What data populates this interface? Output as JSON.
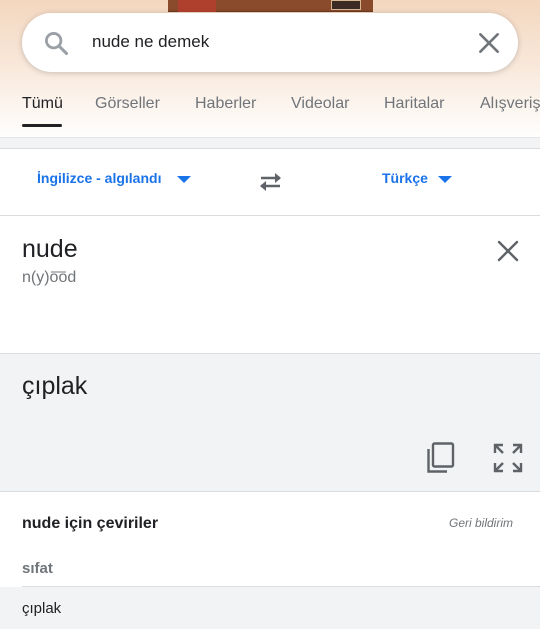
{
  "search": {
    "query": "nude ne demek",
    "icon": "search-icon",
    "clear_icon": "close-icon"
  },
  "tabs": [
    {
      "label": "Tümü",
      "active": true
    },
    {
      "label": "Görseller",
      "active": false
    },
    {
      "label": "Haberler",
      "active": false
    },
    {
      "label": "Videolar",
      "active": false
    },
    {
      "label": "Haritalar",
      "active": false
    },
    {
      "label": "Alışveriş",
      "active": false
    }
  ],
  "translator": {
    "source_lang": "İngilizce - algılandı",
    "target_lang": "Türkçe",
    "source_text": "nude",
    "phonetic": "n(y)o͞od",
    "target_text": "çıplak"
  },
  "translations": {
    "heading": "nude için çeviriler",
    "feedback": "Geri bildirim",
    "part_of_speech": "sıfat",
    "entries": [
      "çıplak"
    ]
  },
  "colors": {
    "accent": "#1a73e8",
    "text": "#202124",
    "muted": "#70757a",
    "panel": "#f1f3f4"
  }
}
